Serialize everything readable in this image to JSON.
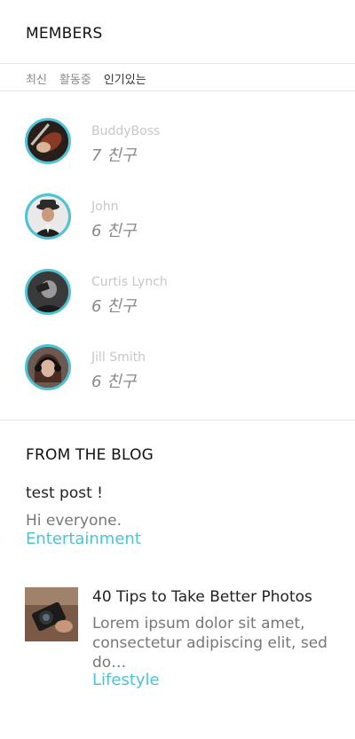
{
  "members": {
    "title": "MEMBERS",
    "tabs": [
      {
        "label": "최신"
      },
      {
        "label": "활동중"
      },
      {
        "label": "인기있는"
      }
    ],
    "items": [
      {
        "name": "BuddyBoss",
        "friends": "7 친구",
        "avatar_icon": "violin-photo-avatar"
      },
      {
        "name": "John",
        "friends": "6 친구",
        "avatar_icon": "man-in-hat-avatar"
      },
      {
        "name": "Curtis Lynch",
        "friends": "6 친구",
        "avatar_icon": "man-bw-avatar"
      },
      {
        "name": "Jill Smith",
        "friends": "6 친구",
        "avatar_icon": "woman-headphones-avatar"
      }
    ]
  },
  "blog": {
    "title": "FROM THE BLOG",
    "posts": [
      {
        "title": "test post !",
        "excerpt": "Hi everyone.",
        "category": "Entertainment"
      },
      {
        "title": "40 Tips to Take Better Photos",
        "excerpt_line1": "Lorem ipsum dolor sit amet,",
        "excerpt_line2": "consectetur adipiscing elit, sed",
        "excerpt_line3": "do…",
        "category": "Lifestyle",
        "thumbnail_icon": "camera-photo-thumbnail"
      }
    ]
  },
  "colors": {
    "accent": "#4cc3d6",
    "muted": "#8a8a8a",
    "divider": "#e6e6e6"
  }
}
